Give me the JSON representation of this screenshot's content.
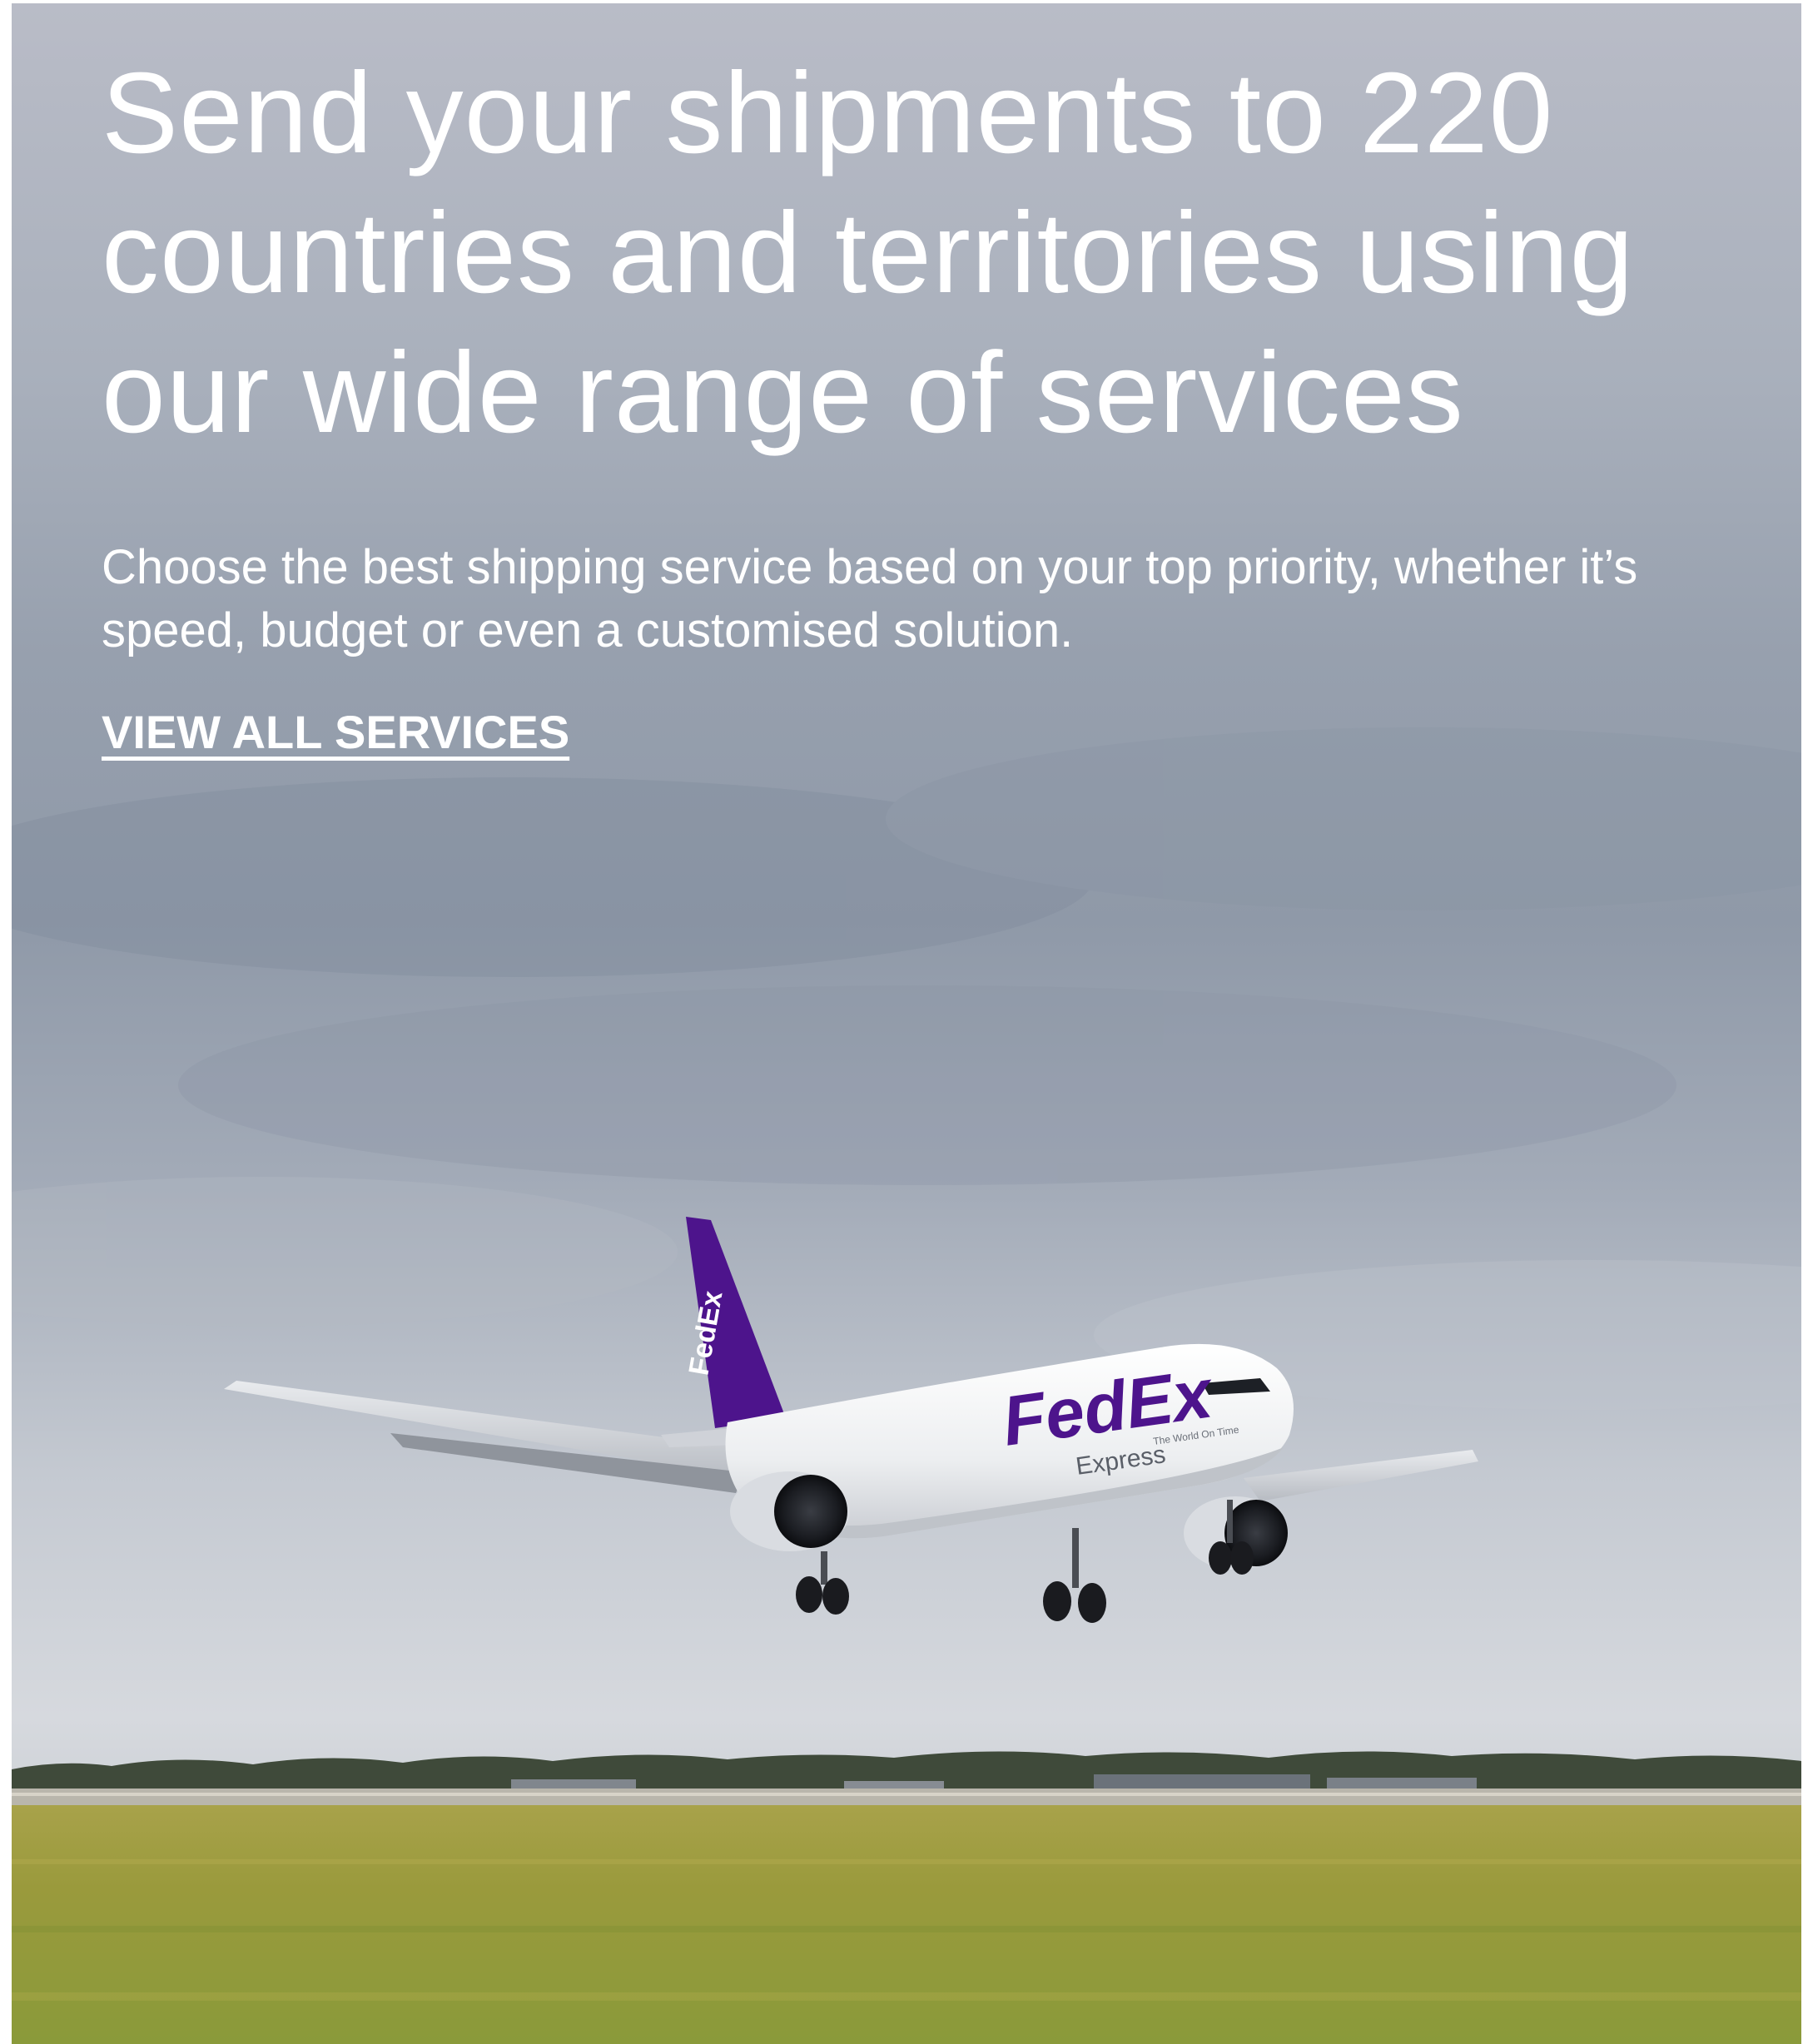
{
  "hero": {
    "headline": "Send your shipments to 220 countries and territories using our wide range of services",
    "subtext": "Choose the best shipping service based on your top priority, whether it’s speed, budget or even a customised solution.",
    "cta_label": "VIEW ALL SERVICES",
    "image": {
      "icon": "fedex-cargo-plane-landing",
      "livery_text": "FedEx",
      "livery_sub": "Express",
      "tail_text": "FedEx",
      "slogan": "The World On Time"
    }
  },
  "colors": {
    "fedex_purple": "#4d148c",
    "fedex_orange": "#ff6600",
    "text": "#ffffff"
  }
}
